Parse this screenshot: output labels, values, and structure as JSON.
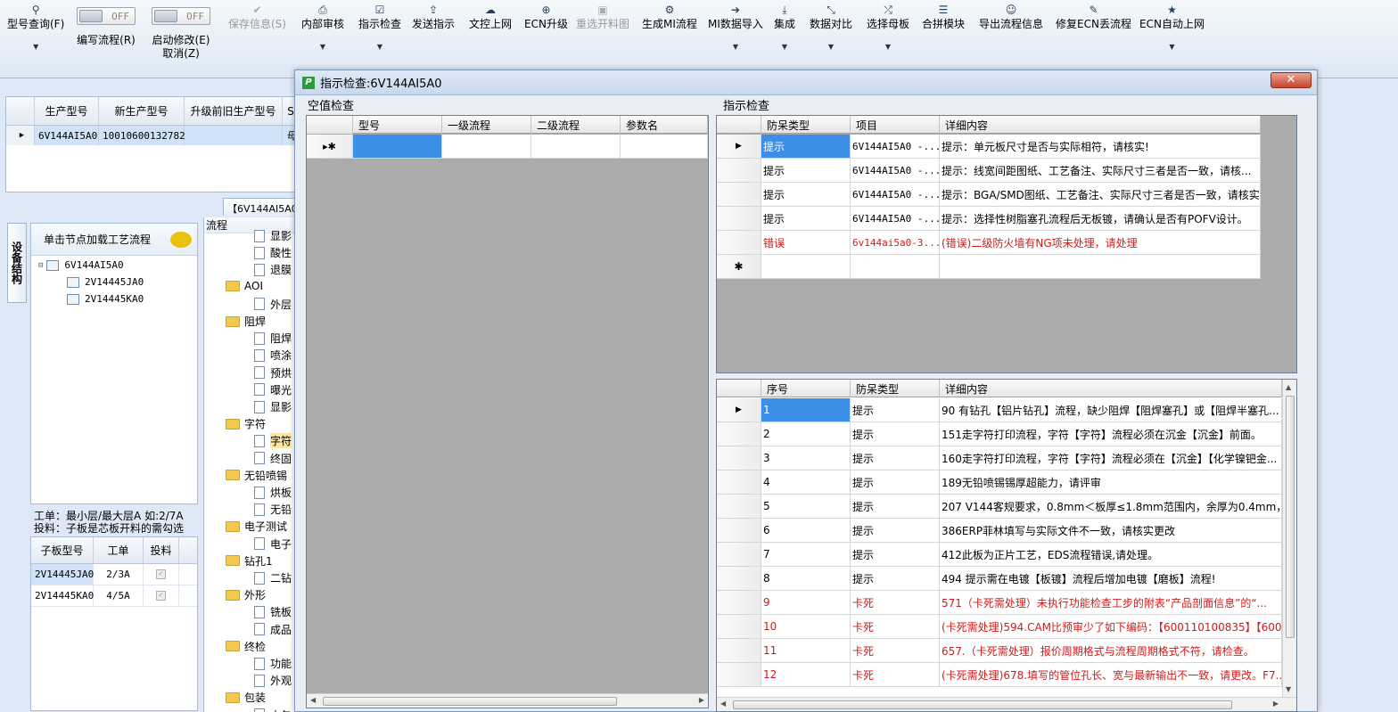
{
  "toolbar": {
    "items": [
      {
        "label": "型号查询(F)",
        "icon": "search-icon",
        "glyph": "⚲",
        "dropdown": true
      },
      {
        "label": "编写流程(R)",
        "toggle": "OFF"
      },
      {
        "label": "启动修改(E)",
        "label2": "取消(Z)",
        "toggle": "OFF"
      },
      {
        "label": "保存信息(S)",
        "icon": "check-icon",
        "glyph": "✔",
        "disabled": true
      },
      {
        "label": "内部审核",
        "icon": "printer-icon",
        "glyph": "⎙",
        "dropdown": true
      },
      {
        "label": "指示检查",
        "icon": "checklist-icon",
        "glyph": "☑",
        "dropdown": true
      },
      {
        "label": "发送指示",
        "icon": "upload-icon",
        "glyph": "⇪"
      },
      {
        "label": "文控上网",
        "icon": "cloud-upload-icon",
        "glyph": "☁"
      },
      {
        "label": "ECN升级",
        "icon": "binoculars-icon",
        "glyph": "⊕"
      },
      {
        "label": "重选开料图",
        "icon": "image-icon",
        "glyph": "▣",
        "disabled": true
      },
      {
        "label": "生成MI流程",
        "icon": "gears-icon",
        "glyph": "⚙"
      },
      {
        "label": "MI数据导入",
        "icon": "import-icon",
        "glyph": "➔",
        "dropdown": true
      },
      {
        "label": "集成",
        "icon": "download-icon",
        "glyph": "⤓",
        "dropdown": true
      },
      {
        "label": "数据对比",
        "icon": "compress-icon",
        "glyph": "⤡",
        "dropdown": true
      },
      {
        "label": "选择母板",
        "icon": "shuffle-icon",
        "glyph": "⤮",
        "dropdown": true
      },
      {
        "label": "合拼模块",
        "icon": "list-icon",
        "glyph": "☰"
      },
      {
        "label": "导出流程信息",
        "icon": "smile-icon",
        "glyph": "☺"
      },
      {
        "label": "修复ECN丢流程",
        "icon": "wrench-icon",
        "glyph": "✎"
      },
      {
        "label": "ECN自动上网",
        "icon": "star-icon",
        "glyph": "★",
        "dropdown": true
      }
    ]
  },
  "main_grid": {
    "columns": [
      "生产型号",
      "新生产型号",
      "升级前旧生产型号",
      "S"
    ],
    "row": [
      "6V144AI5A0",
      "10010600132782",
      "",
      "母"
    ]
  },
  "tab_strip": {
    "label": "【6V144AI5A0"
  },
  "side_tab": {
    "label": "设备结构"
  },
  "tree_panel": {
    "header": "单击节点加载工艺流程",
    "nodes": [
      "6V144AI5A0",
      "2V14445JA0",
      "2V14445KA0"
    ]
  },
  "info": {
    "line1": "工单：最小层/最大层A 如:2/7A",
    "line2": "投料：子板是芯板开料的需勾选"
  },
  "sub_grid": {
    "columns": [
      "子板型号",
      "工单",
      "投料"
    ],
    "rows": [
      {
        "model": "2V14445JA0",
        "order": "2/3A",
        "feed": true
      },
      {
        "model": "2V14445KA0",
        "order": "4/5A",
        "feed": true
      }
    ]
  },
  "process_tree": {
    "header": "流程",
    "items": [
      {
        "type": "doc",
        "text": "显影"
      },
      {
        "type": "doc",
        "text": "酸性"
      },
      {
        "type": "doc",
        "text": "退膜"
      },
      {
        "type": "folder",
        "text": "AOI"
      },
      {
        "type": "doc",
        "text": "外层"
      },
      {
        "type": "folder",
        "text": "阻焊"
      },
      {
        "type": "doc",
        "text": "阻焊"
      },
      {
        "type": "doc",
        "text": "喷涂"
      },
      {
        "type": "doc",
        "text": "预烘"
      },
      {
        "type": "doc",
        "text": "曝光"
      },
      {
        "type": "doc",
        "text": "显影"
      },
      {
        "type": "folder",
        "text": "字符"
      },
      {
        "type": "doc",
        "text": "字符",
        "highlight": true
      },
      {
        "type": "doc",
        "text": "终固"
      },
      {
        "type": "folder",
        "text": "无铅喷锡"
      },
      {
        "type": "doc",
        "text": "烘板"
      },
      {
        "type": "doc",
        "text": "无铅"
      },
      {
        "type": "folder",
        "text": "电子测试"
      },
      {
        "type": "doc",
        "text": "电子"
      },
      {
        "type": "folder",
        "text": "钻孔1"
      },
      {
        "type": "doc",
        "text": "二钻"
      },
      {
        "type": "folder",
        "text": "外形"
      },
      {
        "type": "doc",
        "text": "铣板"
      },
      {
        "type": "doc",
        "text": "成品"
      },
      {
        "type": "folder",
        "text": "终检"
      },
      {
        "type": "doc",
        "text": "功能"
      },
      {
        "type": "doc",
        "text": "外观"
      },
      {
        "type": "folder",
        "text": "包装"
      },
      {
        "type": "doc",
        "text": "内包"
      }
    ]
  },
  "dialog": {
    "title": "指示检查:6V144AI5A0",
    "close": "✕",
    "empty_check": {
      "label": "空值检查",
      "columns": [
        "型号",
        "一级流程",
        "二级流程",
        "参数名"
      ]
    },
    "indicator_check": {
      "label": "指示检查",
      "columns": [
        "防呆类型",
        "项目",
        "详细内容"
      ],
      "rows": [
        {
          "type": "提示",
          "item": "6V144AI5A0 -...",
          "detail": "提示：单元板尺寸是否与实际相符，请核实!",
          "error": false
        },
        {
          "type": "提示",
          "item": "6V144AI5A0 -...",
          "detail": "提示：线宽间距图纸、工艺备注、实际尺寸三者是否一致，请核...",
          "error": false
        },
        {
          "type": "提示",
          "item": "6V144AI5A0 -...",
          "detail": "提示：BGA/SMD图纸、工艺备注、实际尺寸三者是否一致，请核实!",
          "error": false
        },
        {
          "type": "提示",
          "item": "6V144AI5A0 -...",
          "detail": "提示：选择性树脂塞孔流程后无板镀，请确认是否有POFV设计。",
          "error": false
        },
        {
          "type": "错误",
          "item": "6v144ai5a0-3...",
          "detail": "(错误)二级防火墙有NG项未处理，请处理",
          "error": true
        }
      ]
    },
    "sequence_check": {
      "columns": [
        "序号",
        "防呆类型",
        "详细内容"
      ],
      "rows": [
        {
          "no": "1",
          "type": "提示",
          "detail": "90 有钻孔【铝片钻孔】流程，缺少阻焊【阻焊塞孔】或【阻焊半塞孔...",
          "error": false
        },
        {
          "no": "2",
          "type": "提示",
          "detail": "151走字符打印流程，字符【字符】流程必须在沉金【沉金】前面。",
          "error": false
        },
        {
          "no": "3",
          "type": "提示",
          "detail": "160走字符打印流程，字符【字符】流程必须在【沉金】【化学镍钯金...",
          "error": false
        },
        {
          "no": "4",
          "type": "提示",
          "detail": "189无铅喷锡锡厚超能力，请评审",
          "error": false
        },
        {
          "no": "5",
          "type": "提示",
          "detail": "207 V144客规要求，0.8mm＜板厚≤1.8mm范围内，余厚为0.4mm，请核...",
          "error": false
        },
        {
          "no": "6",
          "type": "提示",
          "detail": "386ERP菲林填写与实际文件不一致，请核实更改",
          "error": false
        },
        {
          "no": "7",
          "type": "提示",
          "detail": "412此板为正片工艺，EDS流程错误,请处理。",
          "error": false
        },
        {
          "no": "8",
          "type": "提示",
          "detail": "494 提示需在电镀【板镀】流程后增加电镀【磨板】流程!",
          "error": false
        },
        {
          "no": "9",
          "type": "卡死",
          "detail": "571（卡死需处理）未执行功能检查工步的附表“产品剖面信息”的“...",
          "error": true
        },
        {
          "no": "10",
          "type": "卡死",
          "detail": "(卡死需处理)594.CAM比预审少了如下编码：【600110100835】【60031...",
          "error": true
        },
        {
          "no": "11",
          "type": "卡死",
          "detail": "657.（卡死需处理）报价周期格式与流程周期格式不符，请检查。",
          "error": true
        },
        {
          "no": "12",
          "type": "卡死",
          "detail": "(卡死需处理)678.填写的管位孔长、宽与最新输出不一致，请更改。F7...",
          "error": true
        }
      ]
    }
  },
  "colors": {
    "selection": "#3d8ee6",
    "error_text": "#d21a1a",
    "grid_empty": "#ababab"
  }
}
